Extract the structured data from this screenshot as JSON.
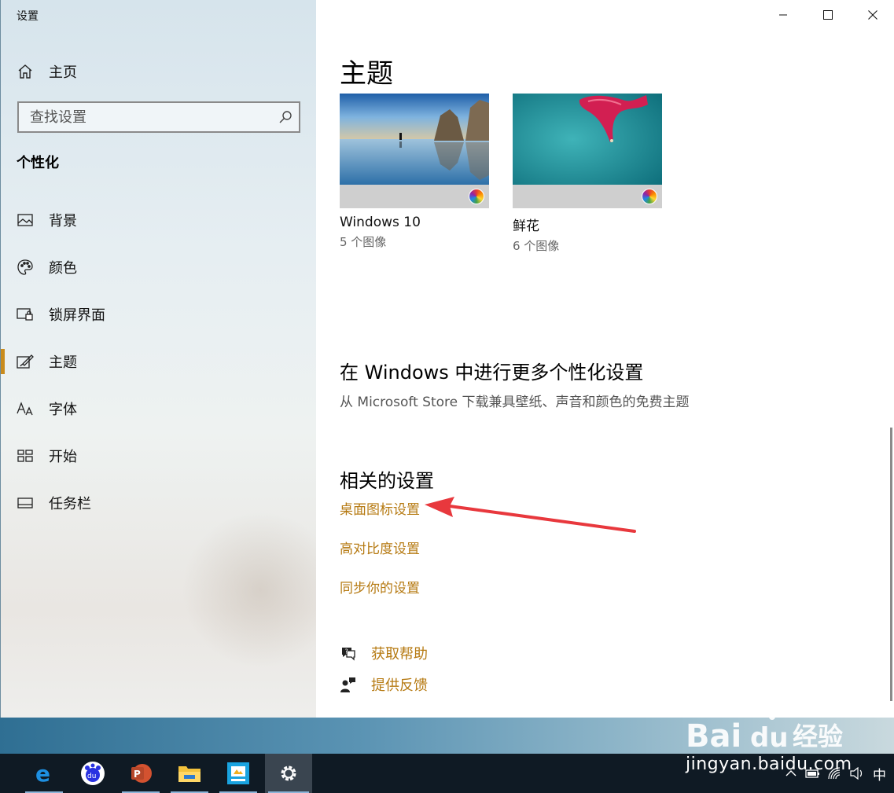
{
  "window": {
    "title": "设置",
    "controls": {
      "minimize": "minimize",
      "maximize": "maximize",
      "close": "close"
    }
  },
  "sidebar": {
    "home_label": "主页",
    "search_placeholder": "查找设置",
    "section_title": "个性化",
    "items": [
      {
        "label": "背景",
        "icon": "picture-icon"
      },
      {
        "label": "颜色",
        "icon": "palette-icon"
      },
      {
        "label": "锁屏界面",
        "icon": "lock-screen-icon"
      },
      {
        "label": "主题",
        "icon": "theme-brush-icon",
        "active": true
      },
      {
        "label": "字体",
        "icon": "font-icon"
      },
      {
        "label": "开始",
        "icon": "start-icon"
      },
      {
        "label": "任务栏",
        "icon": "taskbar-icon"
      }
    ]
  },
  "main": {
    "title": "主题",
    "themes": [
      {
        "name": "Windows 10",
        "count": "5 个图像"
      },
      {
        "name": "鲜花",
        "count": "6 个图像"
      }
    ],
    "more": {
      "title": "在 Windows 中进行更多个性化设置",
      "description": "从 Microsoft Store 下载兼具壁纸、声音和颜色的免费主题"
    },
    "related": {
      "title": "相关的设置",
      "links": [
        "桌面图标设置",
        "高对比度设置",
        "同步你的设置"
      ]
    },
    "help": {
      "get_help": "获取帮助",
      "feedback": "提供反馈"
    }
  },
  "colors": {
    "accent": "#c98b1c",
    "link": "#b67a12",
    "annotation_arrow": "#e8383d",
    "taskbar": "#0f1a24"
  },
  "taskbar": {
    "apps": [
      "edge-icon",
      "baidu-icon",
      "powerpoint-icon",
      "file-explorer-icon",
      "app-icon",
      "settings-gear-icon"
    ],
    "ime": "中"
  },
  "watermark": {
    "brand": "Baidu经验",
    "domain": "jingyan.baidu.com"
  }
}
